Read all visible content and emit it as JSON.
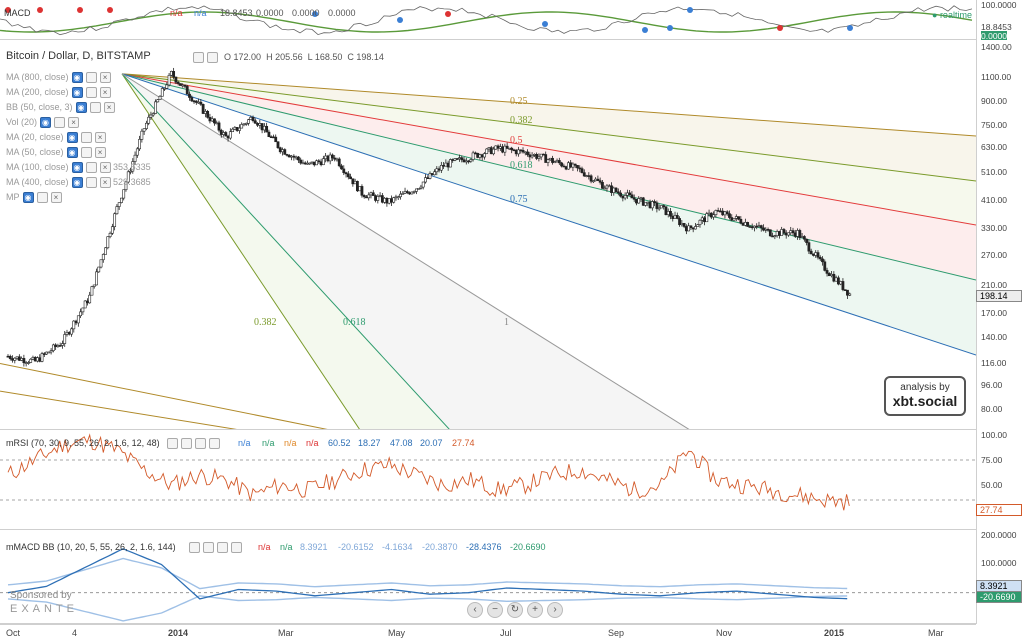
{
  "top_pane": {
    "title": "MACD",
    "values": [
      "n/a",
      "n/a",
      "18.8453",
      "0.0000",
      "0.0000",
      "0.0000"
    ],
    "realtime_label": "realtime",
    "scale_ticks": [
      "100.0000",
      "18.8453",
      "0.0000"
    ]
  },
  "main_pane": {
    "title": "Bitcoin / Dollar, D, BITSTAMP",
    "ohlc": {
      "o_label": "O",
      "o": "172.00",
      "h_label": "H",
      "h": "205.56",
      "l_label": "L",
      "l": "168.50",
      "c_label": "C",
      "c": "198.14"
    },
    "last_price": "198.14",
    "indicators": [
      {
        "label": "MA (800, close)",
        "value": ""
      },
      {
        "label": "MA (200, close)",
        "value": ""
      },
      {
        "label": "BB (50, close, 3)",
        "value": ""
      },
      {
        "label": "Vol (20)",
        "value": ""
      },
      {
        "label": "MA (20, close)",
        "value": ""
      },
      {
        "label": "MA (50, close)",
        "value": ""
      },
      {
        "label": "MA (100, close)",
        "value": "353.6335"
      },
      {
        "label": "MA (400, close)",
        "value": "529.3685"
      },
      {
        "label": "MP",
        "value": ""
      }
    ],
    "fan_labels_top": [
      "0.25",
      "0.382",
      "0.5",
      "0.618",
      "0.75"
    ],
    "fan_labels_bottom": [
      "0.382",
      "0.618",
      "1"
    ],
    "badge_line1": "analysis by",
    "badge_line2": "xbt.social",
    "colors": {
      "up": "#222222",
      "down": "#222222",
      "fan_025": "#b08a2a",
      "fan_0382": "#7a9a2a",
      "fan_05": "#e33b3b",
      "fan_0618": "#2e9b6e",
      "fan_075": "#2d6fb5",
      "fan_1": "#999999"
    }
  },
  "rsi_pane": {
    "title": "mRSI (70, 30, 9, 55, 26, 2, 1.6, 12, 48)",
    "values": [
      "n/a",
      "n/a",
      "n/a",
      "n/a",
      "60.52",
      "18.27",
      "47.08",
      "20.07",
      "27.74"
    ],
    "last_value": "27.74"
  },
  "macd_pane": {
    "title": "mMACD BB (10, 20, 5, 55, 26, 2, 1.6, 144)",
    "values": [
      "n/a",
      "n/a",
      "8.3921",
      "-20.6152",
      "-4.1634",
      "-20.3870",
      "-28.4376",
      "-20.6690"
    ],
    "last_values": [
      "8.3921",
      "-20.6690"
    ]
  },
  "sponsor": {
    "label": "Sponsored by",
    "brand": "EXANTE"
  },
  "nav_buttons": [
    "‹",
    "−",
    "↻",
    "+",
    "›"
  ],
  "chart_data": [
    {
      "type": "line",
      "title": "Bitcoin / Dollar, D, BITSTAMP",
      "scale": "log",
      "ylim": [
        70,
        1500
      ],
      "y_ticks": [
        "1400.00",
        "1100.00",
        "900.00",
        "750.00",
        "630.00",
        "510.00",
        "410.00",
        "330.00",
        "270.00",
        "210.00",
        "170.00",
        "140.00",
        "116.00",
        "96.00",
        "80.00"
      ],
      "x_ticks": [
        "Oct",
        "4",
        "2014",
        "Mar",
        "May",
        "Jul",
        "Sep",
        "Nov",
        "2015",
        "Mar"
      ],
      "series": [
        {
          "name": "",
          "values": [
            125,
            120,
            140,
            200,
            400,
            750,
            1150,
            900,
            700,
            820,
            640,
            560,
            600,
            450,
            420,
            470,
            560,
            600,
            640,
            620,
            580,
            540,
            470,
            430,
            400,
            340,
            390,
            360,
            330,
            330,
            250,
            200
          ]
        }
      ]
    },
    {
      "type": "line",
      "title": "mRSI (70, 30, 9, 55, 26, 2, 1.6, 12, 48)",
      "ylim": [
        0,
        100
      ],
      "y_ticks": [
        "100.00",
        "75.00",
        "50.00",
        "25.00"
      ],
      "series": [
        {
          "name": "",
          "values": [
            55,
            70,
            85,
            90,
            80,
            60,
            45,
            55,
            50,
            35,
            45,
            40,
            50,
            60,
            65,
            55,
            45,
            50,
            40,
            45,
            55,
            60,
            50,
            40,
            45,
            80,
            50,
            45,
            40,
            35,
            30,
            28
          ]
        }
      ]
    },
    {
      "type": "line",
      "title": "mMACD BB (10, 20, 5, 55, 26, 2, 1.6, 144)",
      "ylim": [
        -100,
        200
      ],
      "y_ticks": [
        "200.0000",
        "100.0000"
      ],
      "series": [
        {
          "name": "",
          "values": [
            0,
            20,
            80,
            140,
            90,
            -20,
            10,
            5,
            -10,
            0,
            10,
            -5,
            0,
            15,
            10,
            5,
            -5,
            -10,
            0,
            5,
            -5,
            -15,
            -20
          ]
        }
      ]
    }
  ]
}
